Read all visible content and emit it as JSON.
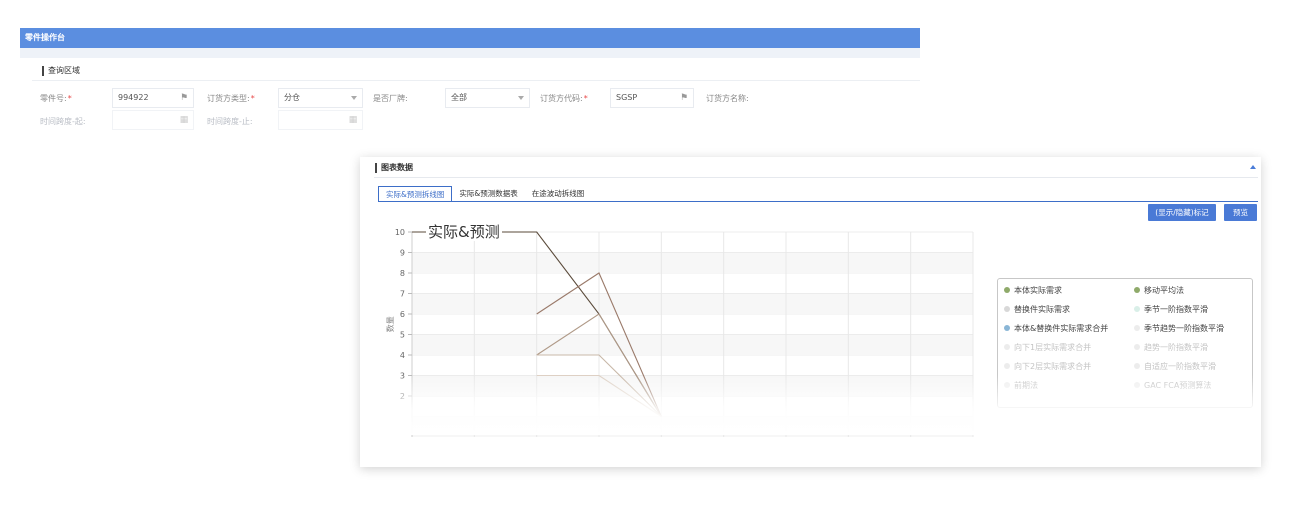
{
  "window": {
    "title": "零件操作台",
    "title_color": "#5b8ee0"
  },
  "query": {
    "section_title": "查询区域",
    "fields": [
      {
        "label": "零件号:",
        "required": true,
        "value": "994922",
        "icon": "binoculars-icon"
      },
      {
        "label": "订货方类型:",
        "required": true,
        "value": "分仓",
        "icon": "chevron-down-icon"
      },
      {
        "label": "是否厂牌:",
        "required": false,
        "value": "全部",
        "icon": "chevron-down-icon"
      },
      {
        "label": "订货方代码:",
        "required": true,
        "value": "SGSP",
        "icon": "binoculars-icon"
      },
      {
        "label": "订货方名称:",
        "required": false,
        "value": ""
      },
      {
        "label": "时间跨度-起:",
        "required": false,
        "value": "",
        "icon": "calendar-icon"
      },
      {
        "label": "时间跨度-止:",
        "required": false,
        "value": "",
        "icon": "calendar-icon"
      }
    ],
    "required_mark": "*"
  },
  "chart_panel": {
    "title": "图表数据",
    "tabs": [
      "实际&预测拆线图",
      "实际&预测数据表",
      "在途波动拆线图"
    ],
    "active_tab": 0,
    "buttons": {
      "toggle_marks": "(显示/隐藏)标记",
      "preview": "预览"
    },
    "accent_color": "#4a7ad6"
  },
  "chart_data": {
    "type": "line",
    "title": "实际&预测",
    "ylabel": "数量",
    "ylim": [
      0,
      10
    ],
    "yticks": [
      "10",
      "9",
      "8",
      "7",
      "6",
      "5",
      "4",
      "3",
      "2"
    ],
    "grid": true,
    "x": [
      1,
      2,
      3,
      4,
      5,
      6,
      7,
      8,
      9
    ],
    "series": [
      {
        "name": "本体实际需求",
        "color": "#5a4a3a",
        "values": [
          10,
          10,
          10,
          6,
          1,
          null,
          null,
          null,
          null
        ]
      },
      {
        "name": "移动平均法",
        "color": "#9a7a6a",
        "values": [
          null,
          null,
          6,
          8,
          1,
          null,
          null,
          null,
          null
        ]
      },
      {
        "name": "本体&替换件实际需求合并",
        "color": "#b09a88",
        "values": [
          null,
          null,
          4,
          6,
          1,
          null,
          null,
          null,
          null
        ]
      },
      {
        "name": "季节一阶指数平滑",
        "color": "#c8b8a8",
        "values": [
          null,
          null,
          4,
          4,
          1,
          null,
          null,
          null,
          null
        ]
      },
      {
        "name": "趋势一阶指数平滑",
        "color": "#ddd0c4",
        "values": [
          null,
          null,
          3,
          3,
          1,
          null,
          null,
          null,
          null
        ]
      }
    ],
    "legend": {
      "placement": "right",
      "items": [
        {
          "label": "本体实际需求",
          "color": "#8faa6a",
          "faint": false
        },
        {
          "label": "移动平均法",
          "color": "#8faa6a",
          "faint": false
        },
        {
          "label": "替换件实际需求",
          "color": "#d8d8d8",
          "faint": false
        },
        {
          "label": "季节一阶指数平滑",
          "color": "#d9efe8",
          "faint": false
        },
        {
          "label": "本体&替换件实际需求合并",
          "color": "#8ab6d6",
          "faint": false
        },
        {
          "label": "季节趋势一阶指数平滑",
          "color": "#ececec",
          "faint": false
        },
        {
          "label": "向下1层实际需求合并",
          "color": "#ececec",
          "faint": true
        },
        {
          "label": "趋势一阶指数平滑",
          "color": "#ececec",
          "faint": true
        },
        {
          "label": "向下2层实际需求合并",
          "color": "#ececec",
          "faint": true
        },
        {
          "label": "自适应一阶指数平滑",
          "color": "#ececec",
          "faint": true
        },
        {
          "label": "前期法",
          "color": "#f0f0f0",
          "faint": true
        },
        {
          "label": "GAC FCA预测算法",
          "color": "#f0f0f0",
          "faint": true
        }
      ]
    }
  }
}
